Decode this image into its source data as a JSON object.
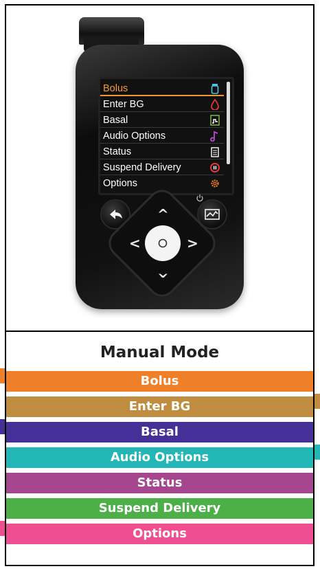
{
  "device": {
    "screen_menu": [
      {
        "label": "Bolus",
        "icon": "bolus-vial-icon",
        "active": true
      },
      {
        "label": "Enter BG",
        "icon": "blood-drop-icon",
        "active": false
      },
      {
        "label": "Basal",
        "icon": "basal-graph-icon",
        "active": false
      },
      {
        "label": "Audio Options",
        "icon": "music-note-icon",
        "active": false
      },
      {
        "label": "Status",
        "icon": "clipboard-icon",
        "active": false
      },
      {
        "label": "Suspend Delivery",
        "icon": "pause-circle-icon",
        "active": false
      },
      {
        "label": "Options",
        "icon": "gear-icon",
        "active": false
      }
    ]
  },
  "legend": {
    "title": "Manual Mode",
    "items": [
      {
        "label": "Bolus",
        "color": "#f07f2a"
      },
      {
        "label": "Enter BG",
        "color": "#c08c3f"
      },
      {
        "label": "Basal",
        "color": "#453098"
      },
      {
        "label": "Audio Options",
        "color": "#22b7b6"
      },
      {
        "label": "Status",
        "color": "#a5468f"
      },
      {
        "label": "Suspend Delivery",
        "color": "#4caf48"
      },
      {
        "label": "Options",
        "color": "#ef4f91"
      }
    ]
  }
}
